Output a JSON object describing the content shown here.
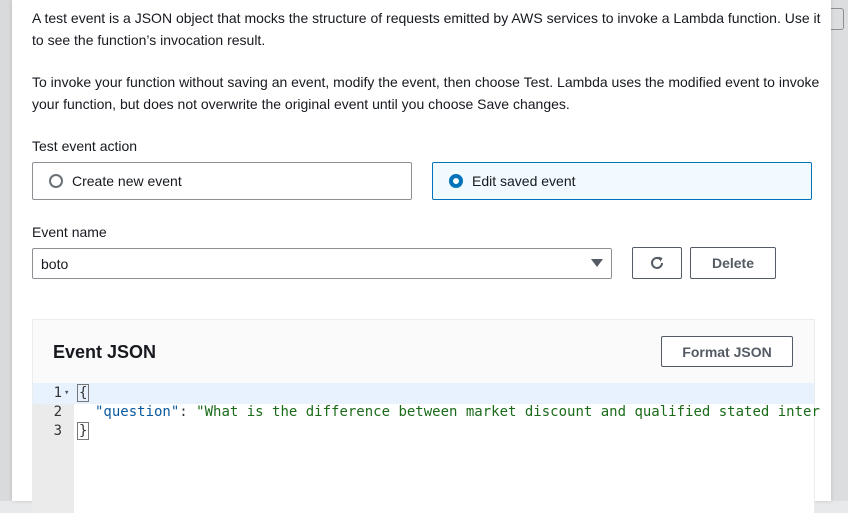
{
  "intro": {
    "paragraph1": "A test event is a JSON object that mocks the structure of requests emitted by AWS services to invoke a Lambda function. Use it to see the function’s invocation result.",
    "paragraph2": "To invoke your function without saving an event, modify the event, then choose Test. Lambda uses the modified event to invoke your function, but does not overwrite the original event until you choose Save changes."
  },
  "test_event_action": {
    "label": "Test event action",
    "options": [
      {
        "label": "Create new event",
        "selected": false
      },
      {
        "label": "Edit saved event",
        "selected": true
      }
    ]
  },
  "event_name": {
    "label": "Event name",
    "value": "boto",
    "refresh_icon": "refresh-icon",
    "delete_label": "Delete"
  },
  "event_json": {
    "title": "Event JSON",
    "format_label": "Format JSON",
    "lines": [
      {
        "num": "1",
        "open": "{"
      },
      {
        "num": "2",
        "key": "\"question\"",
        "sep": ": ",
        "value": "\"What is the difference between market discount and qualified stated inter"
      },
      {
        "num": "3",
        "close": "}"
      }
    ]
  },
  "colors": {
    "accent": "#0073bb",
    "selected_bg": "#f1faff",
    "json_key": "#0b5aa0",
    "json_string": "#1a6b1a"
  }
}
